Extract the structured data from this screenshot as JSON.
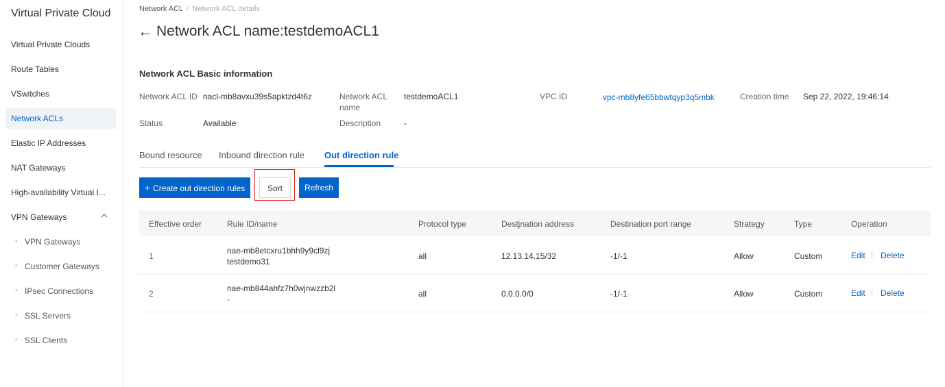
{
  "sidebar": {
    "title": "Virtual Private Cloud",
    "items": [
      {
        "label": "Virtual Private Clouds"
      },
      {
        "label": "Route Tables"
      },
      {
        "label": "VSwitches"
      },
      {
        "label": "Network ACLs",
        "active": true
      },
      {
        "label": "Elastic IP Addresses"
      },
      {
        "label": "NAT Gateways"
      },
      {
        "label": "High-availability Virtual I..."
      },
      {
        "label": "VPN Gateways",
        "expanded": true,
        "icon": "chevron-up-icon"
      }
    ],
    "sub_items": [
      {
        "label": "VPN Gateways"
      },
      {
        "label": "Customer Gateways"
      },
      {
        "label": "IPsec Connections"
      },
      {
        "label": "SSL Servers"
      },
      {
        "label": "SSL Clients"
      }
    ]
  },
  "breadcrumb": {
    "items": [
      "Network ACL",
      "Network ACL details"
    ],
    "separator": "/"
  },
  "page": {
    "title": "Network ACL name:testdemoACL1",
    "back_icon": "arrow-left-icon"
  },
  "basic_info": {
    "heading": "Network ACL Basic information",
    "acl_id_label": "Network ACL ID",
    "acl_id": "nacl-mb8avxu39s5apktzd4t6z",
    "acl_name_label_line1": "Network ACL",
    "acl_name_label_line2": "name",
    "acl_name": "testdemoACL1",
    "vpc_id_label": "VPC ID",
    "vpc_id": "vpc-mb8yfe65bbwtqyp3q5mbk",
    "creation_time_label": "Creation time",
    "creation_time": "Sep 22, 2022, 19:46:14",
    "status_label": "Status",
    "status": "Available",
    "description_label": "Description",
    "description": "-"
  },
  "tabs": [
    {
      "label": "Bound resource"
    },
    {
      "label": "Inbound direction rule"
    },
    {
      "label": "Out direction rule",
      "active": true
    }
  ],
  "toolbar": {
    "create_label": "Create out direction rules",
    "create_icon": "plus-icon",
    "sort_label": "Sort",
    "refresh_label": "Refresh"
  },
  "table": {
    "columns": [
      "Effective order",
      "Rule ID/name",
      "Protocol type",
      "Destjnation address",
      "Destination port range",
      "Strategy",
      "Type",
      "Operation"
    ],
    "rows": [
      {
        "order": "1",
        "rule_id": "nae-mb8etcxru1bhh9y9cl9zj",
        "rule_name": "testdemo31",
        "protocol": "all",
        "destination": "12.13.14.15/32",
        "port_range": "-1/-1",
        "strategy": "Allow",
        "type": "Custom",
        "edit": "Edit",
        "delete": "Delete"
      },
      {
        "order": "2",
        "rule_id": "nae-mb844ahfz7h0wjnwzzb2l",
        "rule_name": "-",
        "protocol": "all",
        "destination": "0.0.0.0/0",
        "port_range": "-1/-1",
        "strategy": "Allow",
        "type": "Custom",
        "edit": "Edit",
        "delete": "Delete"
      }
    ]
  },
  "colors": {
    "accent": "#0064c8",
    "highlight": "#e02020"
  }
}
